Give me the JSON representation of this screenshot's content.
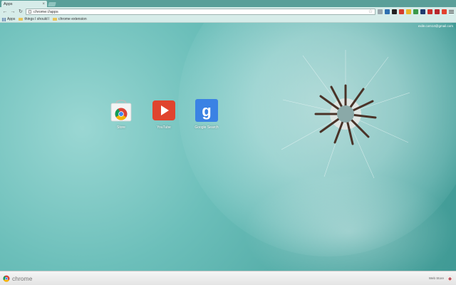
{
  "window": {
    "tab_title": "Apps",
    "tab_close": "×"
  },
  "toolbar": {
    "back_icon": "arrow-left-icon",
    "forward_icon": "arrow-right-icon",
    "reload_icon": "reload-icon",
    "url": "chrome://apps",
    "star_icon": "star-icon",
    "extensions": [
      "gray-puzzle-icon",
      "blue-icon",
      "black-icon",
      "red-icon",
      "yellow-icon",
      "green-icon",
      "navy-icon",
      "red-icon",
      "red-icon",
      "red-icon"
    ]
  },
  "bookmarks": [
    {
      "label": "Apps",
      "type": "apps"
    },
    {
      "label": "things I should l",
      "type": "folder"
    },
    {
      "label": "chrome extension",
      "type": "folder"
    }
  ],
  "user": {
    "email": "exile.com14@gmail.com"
  },
  "apps": [
    {
      "label": "Store",
      "icon": "chrome-web-store-icon"
    },
    {
      "label": "YouTube",
      "icon": "youtube-icon"
    },
    {
      "label": "Google Search",
      "icon": "google-search-icon"
    }
  ],
  "bottom_bar": {
    "brand": "chrome",
    "webstore_label": "Web Store"
  },
  "colors": {
    "background": "#5fb3ae",
    "chrome_frame": "#d6ece9",
    "youtube_red": "#e0442e",
    "google_blue": "#3a82e4"
  }
}
